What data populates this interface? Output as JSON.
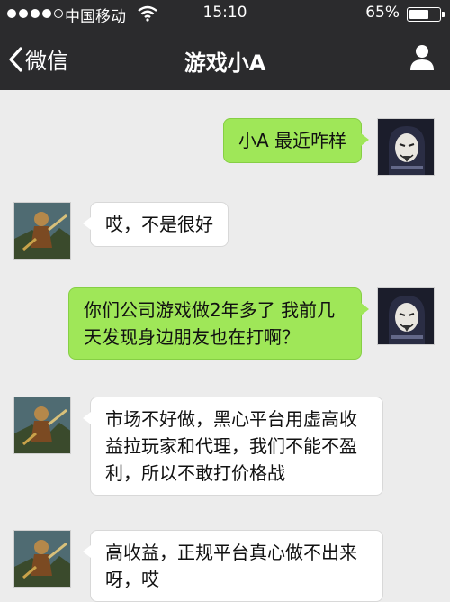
{
  "status_bar": {
    "carrier": "中国移动",
    "time": "15:10",
    "battery_percent": "65%",
    "battery_level": 0.65,
    "signal_bars_filled": 4,
    "icons": [
      "signal-dots-icon",
      "wifi-icon",
      "battery-icon"
    ]
  },
  "nav": {
    "back_label": "微信",
    "title": "游戏小A",
    "icons": [
      "back-chevron-icon",
      "profile-icon"
    ]
  },
  "messages": [
    {
      "sender": "me",
      "text": "小A 最近咋样"
    },
    {
      "sender": "contact",
      "text": "哎，不是很好"
    },
    {
      "sender": "me",
      "text": "你们公司游戏做2年多了 我前几天发现身边朋友也在打啊？"
    },
    {
      "sender": "contact",
      "text": "市场不好做，黑心平台用虚高收益拉玩家和代理，我们不能不盈利，所以不敢打价格战"
    },
    {
      "sender": "contact",
      "text": "高收益，正规平台真心做不出来呀，哎"
    }
  ],
  "colors": {
    "header_bg": "#2b2b2d",
    "chat_bg": "#ececec",
    "outgoing_bubble": "#9fe758",
    "incoming_bubble": "#ffffff"
  }
}
